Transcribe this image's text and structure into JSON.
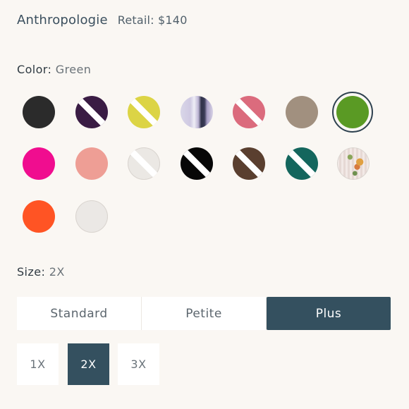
{
  "header": {
    "brand": "Anthropologie",
    "price": "Retail: $140"
  },
  "color": {
    "label": "Color:",
    "value": "Green",
    "selected_index": 6,
    "swatches": [
      {
        "name": "black",
        "hex": "#2b2b2b",
        "available": true
      },
      {
        "name": "purple",
        "hex": "#3a1c44",
        "available": false
      },
      {
        "name": "yellow",
        "hex": "#dcd445",
        "available": false
      },
      {
        "name": "lavender-stripe",
        "hex": "#d8d3e6",
        "available": true
      },
      {
        "name": "pink",
        "hex": "#db6b7d",
        "available": false
      },
      {
        "name": "taupe",
        "hex": "#a1907f",
        "available": true
      },
      {
        "name": "green",
        "hex": "#5a9a24",
        "available": true
      },
      {
        "name": "magenta",
        "hex": "#f00d8f",
        "available": true
      },
      {
        "name": "salmon",
        "hex": "#ee9e95",
        "available": true
      },
      {
        "name": "off-white",
        "hex": "#ebe8e4",
        "available": false
      },
      {
        "name": "black-2",
        "hex": "#070707",
        "available": false
      },
      {
        "name": "brown",
        "hex": "#5a3f2f",
        "available": false
      },
      {
        "name": "teal",
        "hex": "#14665d",
        "available": false
      },
      {
        "name": "floral-print",
        "hex": "#ece1dc",
        "available": true
      },
      {
        "name": "orange",
        "hex": "#ff5424",
        "available": true
      },
      {
        "name": "ivory",
        "hex": "#ebe8e5",
        "available": true
      }
    ]
  },
  "size": {
    "label": "Size:",
    "value": "2X",
    "fits": [
      "Standard",
      "Petite",
      "Plus"
    ],
    "active_fit": "Plus",
    "sizes": [
      "1X",
      "2X",
      "3X"
    ],
    "active_size": "2X"
  },
  "colors": {
    "accent": "#34505f",
    "ring": "#2f4250",
    "background": "#faf7f3"
  }
}
